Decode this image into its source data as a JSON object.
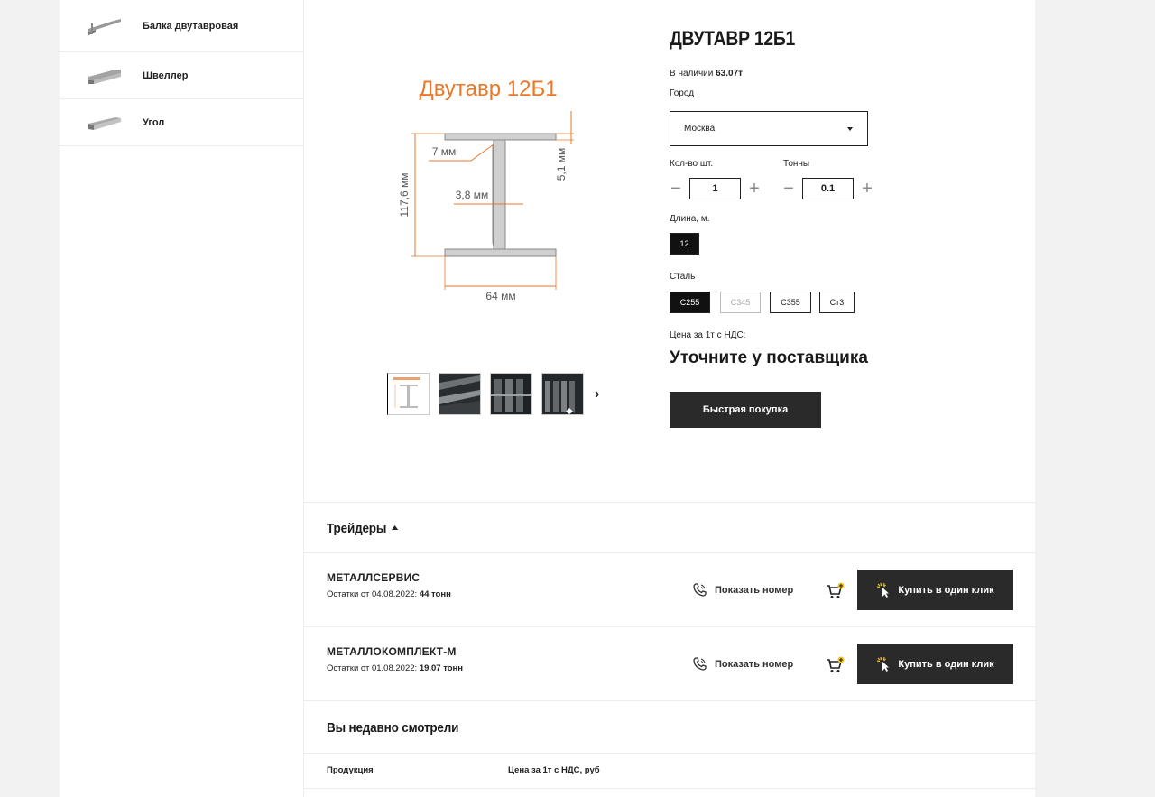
{
  "sidebar": {
    "items": [
      {
        "label": "Балка двутавровая",
        "icon": "i-beam-icon"
      },
      {
        "label": "Швеллер",
        "icon": "channel-icon"
      },
      {
        "label": "Угол",
        "icon": "angle-icon"
      }
    ]
  },
  "product": {
    "title": "ДВУТАВР 12Б1",
    "stock_prefix": "В наличии",
    "stock_value": "63.07т",
    "city_label": "Город",
    "city_value": "Москва",
    "qty_label": "Кол-во шт.",
    "qty_value": "1",
    "tons_label": "Тонны",
    "tons_value": "0.1",
    "length_label": "Длина, м.",
    "length_value": "12",
    "steel_label": "Сталь",
    "steel_options": [
      "С255",
      "С345",
      "С355",
      "Ст3"
    ],
    "price_label": "Цена за 1т с НДС:",
    "price_value": "Уточните у поставщика",
    "quick_buy_label": "Быстрая покупка"
  },
  "image": {
    "caption": "Двутавр 12Б1",
    "dim_flange": "7 мм",
    "dim_thickness": "5,1 мм",
    "dim_height": "117,6 мм",
    "dim_web": "3,8 мм",
    "dim_width": "64 мм",
    "accent": "#e8782a"
  },
  "traders": {
    "title": "Трейдеры",
    "items": [
      {
        "name": "МЕТАЛЛСЕРВИС",
        "stock_prefix": "Остатки от 04.08.2022:",
        "stock_value": "44 тонн",
        "phone_label": "Показать номер",
        "buy_label": "Купить в один клик"
      },
      {
        "name": "МЕТАЛЛОКОМПЛЕКТ-М",
        "stock_prefix": "Остатки от 01.08.2022:",
        "stock_value": "19.07 тонн",
        "phone_label": "Показать номер",
        "buy_label": "Купить в один клик"
      }
    ]
  },
  "recent": {
    "title": "Вы недавно смотрели",
    "col_product": "Продукция",
    "col_price": "Цена за 1т с НДС, руб"
  }
}
